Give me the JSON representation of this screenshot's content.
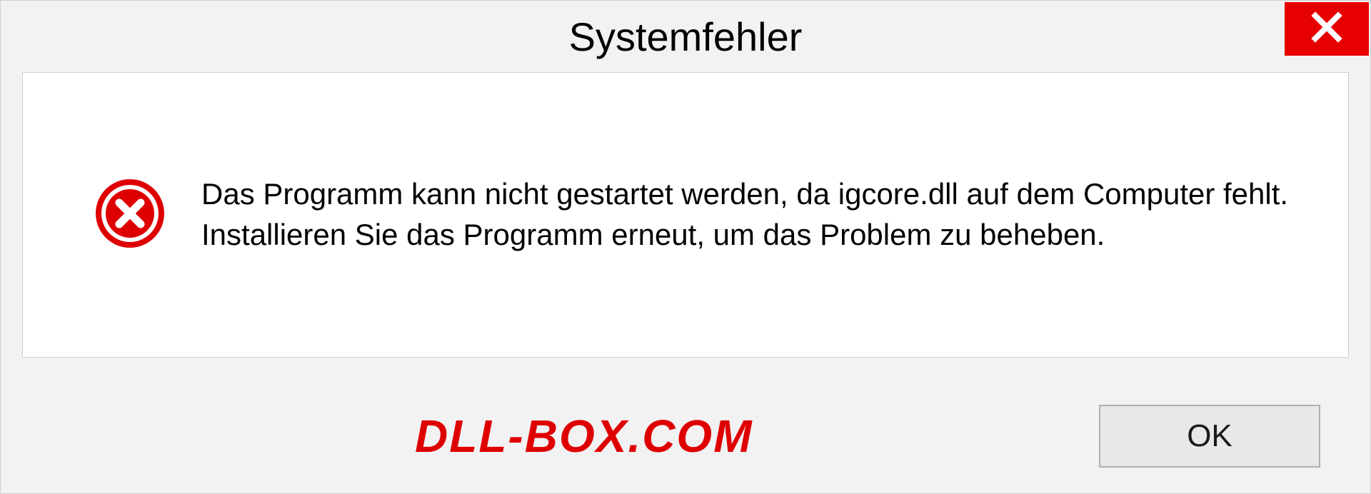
{
  "dialog": {
    "title": "Systemfehler",
    "message": "Das Programm kann nicht gestartet werden, da igcore.dll auf dem Computer fehlt. Installieren Sie das Programm erneut, um das Problem zu beheben.",
    "ok_label": "OK"
  },
  "watermark": "DLL-BOX.COM"
}
